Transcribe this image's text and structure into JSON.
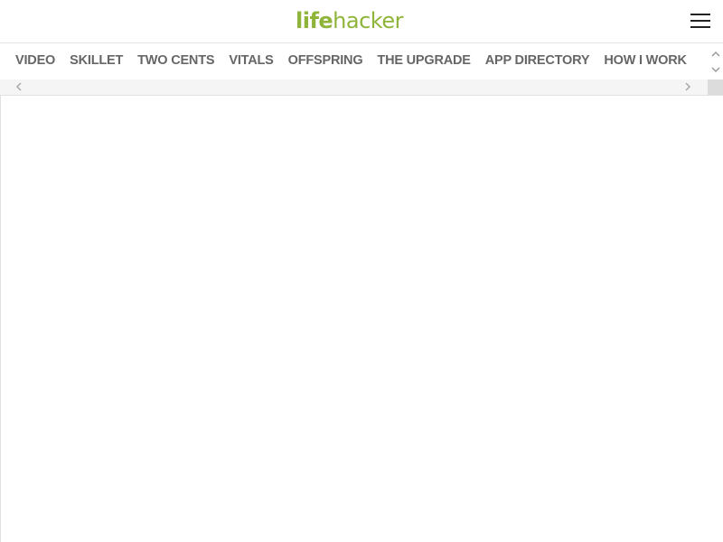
{
  "header": {
    "logo_part1": "life",
    "logo_part2": "hacker",
    "menu_icon": "hamburger-icon",
    "brand_color": "#8fb43a"
  },
  "nav": {
    "items": [
      {
        "label": "VIDEO"
      },
      {
        "label": "SKILLET"
      },
      {
        "label": "TWO CENTS"
      },
      {
        "label": "VITALS"
      },
      {
        "label": "OFFSPRING"
      },
      {
        "label": "THE UPGRADE"
      },
      {
        "label": "APP DIRECTORY"
      },
      {
        "label": "HOW I WORK"
      }
    ],
    "text_color": "#666666"
  },
  "scrollbars": {
    "up_icon": "chevron-up-icon",
    "down_icon": "chevron-down-icon",
    "left_icon": "chevron-left-icon",
    "right_icon": "chevron-right-icon"
  }
}
